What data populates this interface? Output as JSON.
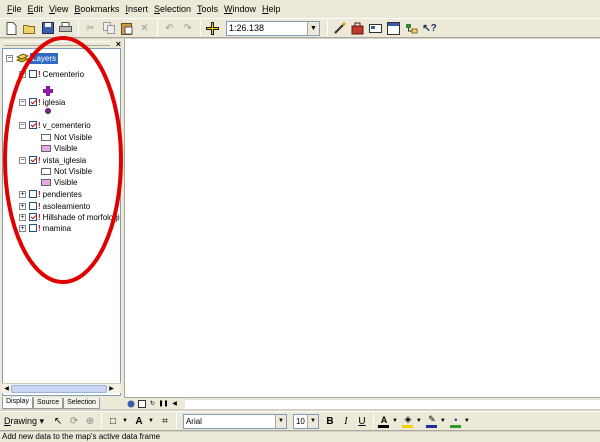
{
  "menu": [
    {
      "mnemonic": "F",
      "rest": "ile"
    },
    {
      "mnemonic": "E",
      "rest": "dit"
    },
    {
      "mnemonic": "V",
      "rest": "iew"
    },
    {
      "mnemonic": "B",
      "rest": "ookmarks"
    },
    {
      "mnemonic": "I",
      "rest": "nsert"
    },
    {
      "mnemonic": "S",
      "rest": "election"
    },
    {
      "mnemonic": "T",
      "rest": "ools"
    },
    {
      "mnemonic": "W",
      "rest": "indow"
    },
    {
      "mnemonic": "H",
      "rest": "elp"
    }
  ],
  "toolbar": {
    "scale": "1:26.138",
    "icons": [
      "new-document-icon",
      "open-folder-icon",
      "save-icon",
      "print-icon",
      "cut-icon",
      "copy-icon",
      "paste-icon",
      "delete-icon",
      "undo-icon",
      "redo-icon",
      "add-data-icon",
      "editor-icon",
      "arctoolbox-icon",
      "model-builder-icon",
      "python-window-icon",
      "arccatalog-icon",
      "whats-this-icon"
    ]
  },
  "toc": {
    "root": "Layers",
    "layers": [
      {
        "name": "Cementerio",
        "checked": false,
        "expanded": true
      },
      {
        "name": "iglesia",
        "checked": true,
        "expanded": true
      },
      {
        "name": "v_cementerio",
        "checked": true,
        "expanded": true
      },
      {
        "name": "vista_iglesia",
        "checked": true,
        "expanded": true
      },
      {
        "name": "pendientes",
        "checked": false,
        "expanded": false
      },
      {
        "name": "asoleamiento",
        "checked": false,
        "expanded": false
      },
      {
        "name": "Hillshade of morfologi",
        "checked": true,
        "expanded": false
      },
      {
        "name": "mamina",
        "checked": false,
        "expanded": false
      }
    ],
    "legend": {
      "not_visible": "Not Visible",
      "visible": "Visible",
      "not_visible_color": "#ffffff",
      "visible_color": "#e6a8e6",
      "symbol_color": "#8a1aa0"
    },
    "tabs": [
      "Display",
      "Source",
      "Selection"
    ]
  },
  "drawbar": {
    "menu": {
      "mnemonic": "D",
      "rest": "rawing"
    },
    "font": "Arial",
    "size": "10",
    "bold": "B",
    "italic": "I",
    "underline": "U"
  },
  "status": "Add new data to the map's active data frame",
  "annotation_color": "#e00000"
}
